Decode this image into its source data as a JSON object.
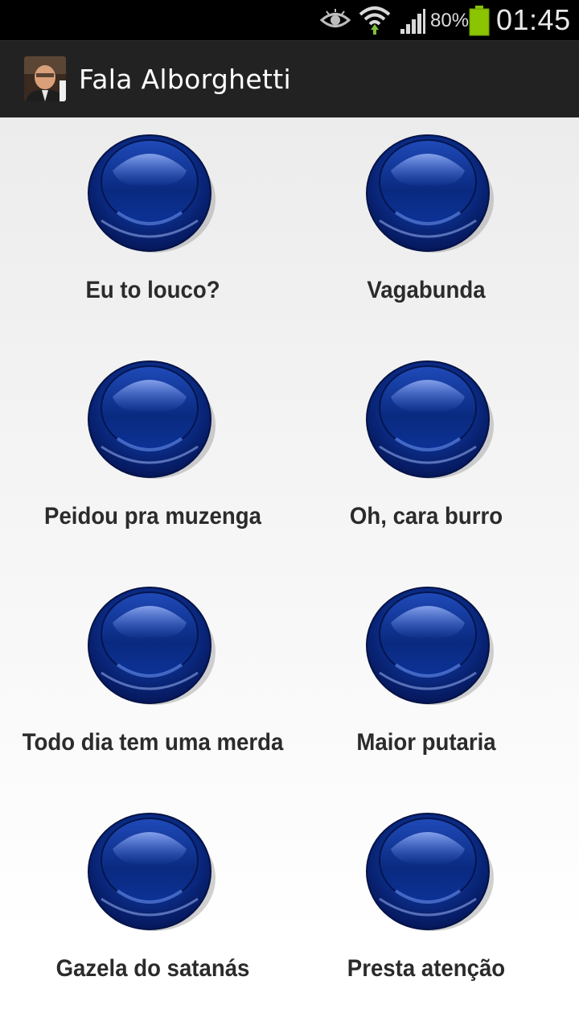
{
  "status_bar": {
    "battery_percent": "80%",
    "time": "01:45",
    "icons": [
      "eye-icon",
      "wifi-icon",
      "signal-icon",
      "battery-icon"
    ]
  },
  "action_bar": {
    "title": "Fala Alborghetti",
    "icon": "app-avatar-icon"
  },
  "buttons": [
    {
      "label": "Eu to louco?"
    },
    {
      "label": "Vagabunda"
    },
    {
      "label": "Peidou pra muzenga"
    },
    {
      "label": "Oh, cara burro"
    },
    {
      "label": "Todo dia tem uma merda"
    },
    {
      "label": "Maior putaria"
    },
    {
      "label": "Gazela do satanás"
    },
    {
      "label": "Presta atenção"
    }
  ],
  "colors": {
    "button_blue": "#0b2f86",
    "action_bar": "#222222",
    "battery_green": "#8bc400"
  }
}
